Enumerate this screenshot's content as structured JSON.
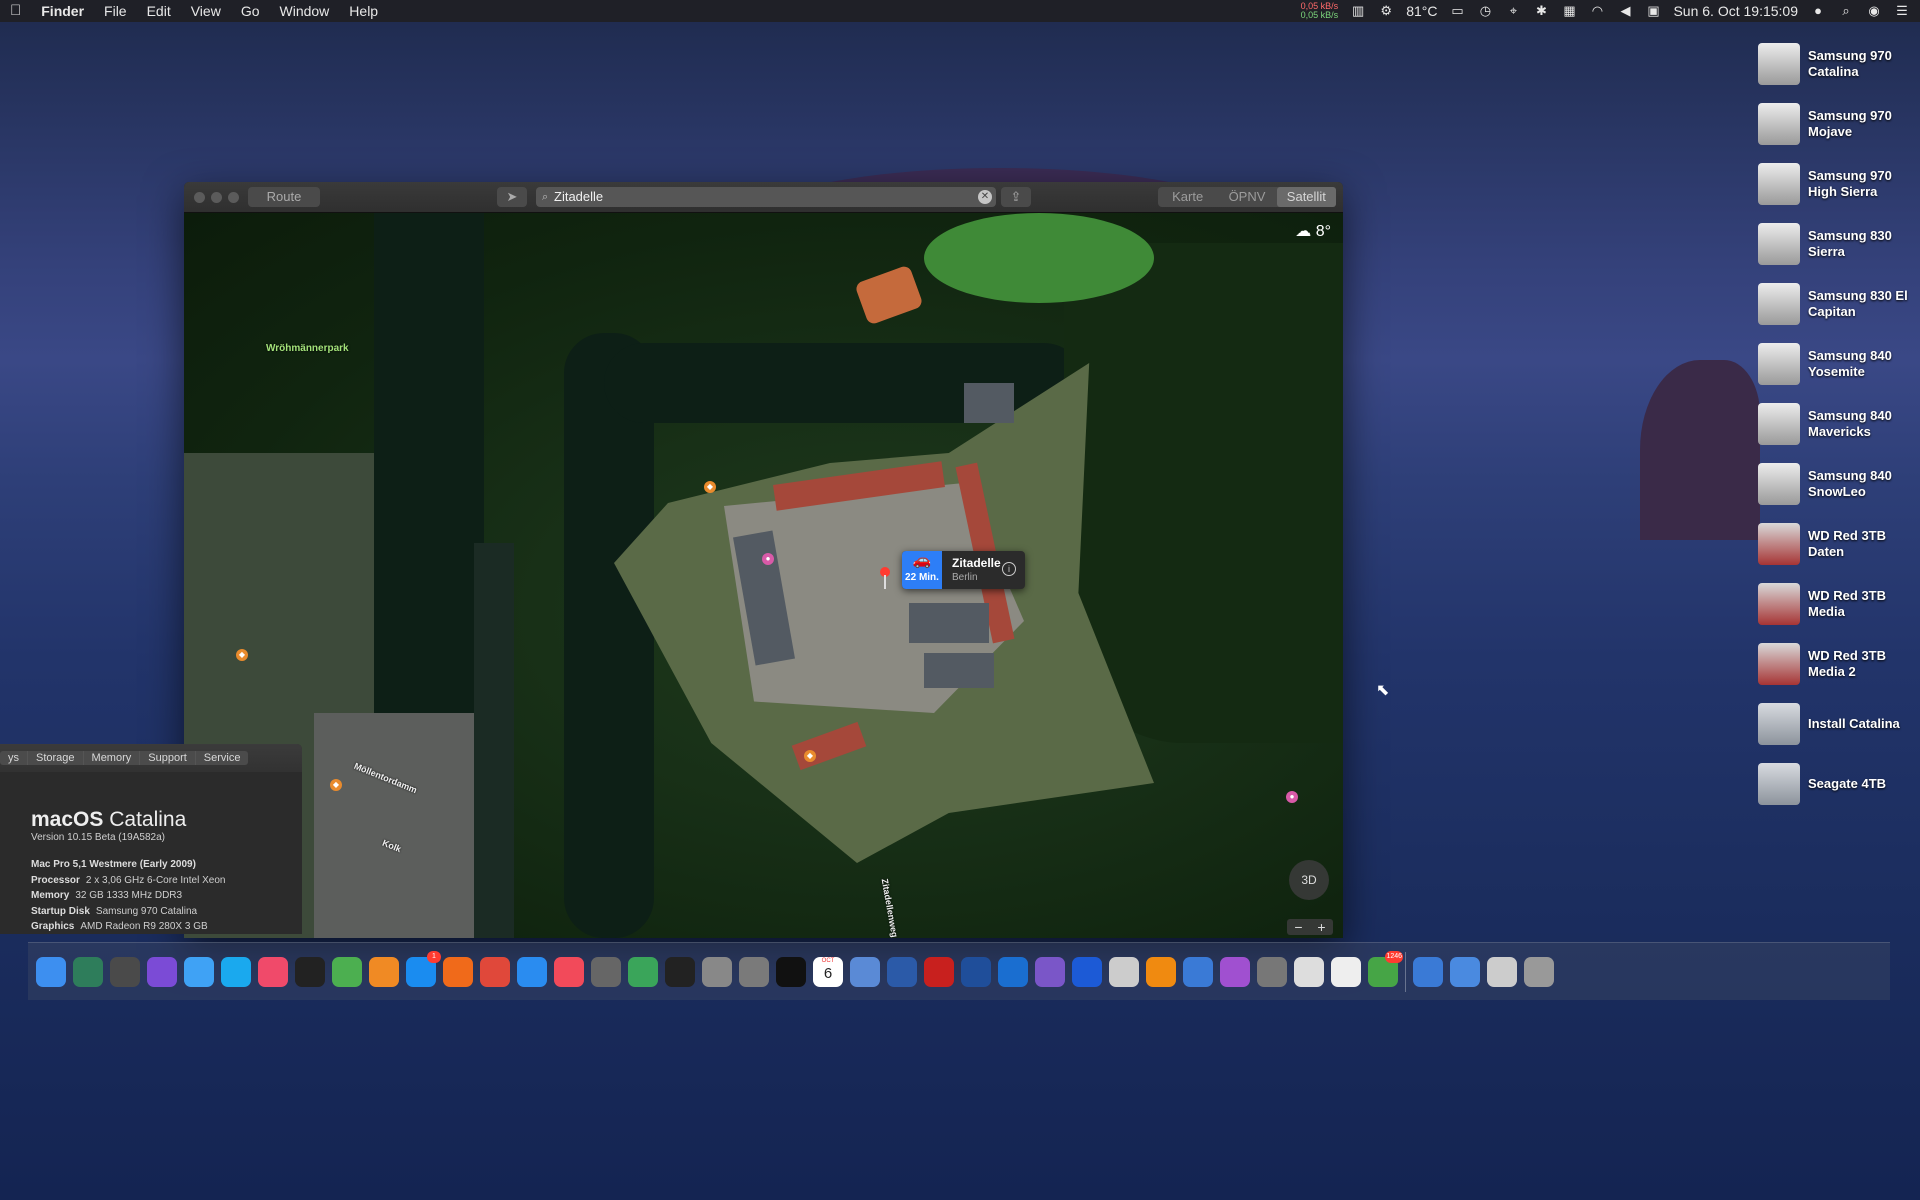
{
  "menubar": {
    "app": "Finder",
    "menus": [
      "File",
      "Edit",
      "View",
      "Go",
      "Window",
      "Help"
    ],
    "net_up": "0,05 kB/s",
    "net_down": "0,05 kB/s",
    "temp": "81°C",
    "datetime": "Sun 6. Oct  19:15:09"
  },
  "desktop": [
    {
      "line1": "Samsung 970",
      "line2": "Catalina",
      "kind": "ssd"
    },
    {
      "line1": "Samsung 970",
      "line2": "Mojave",
      "kind": "ssd"
    },
    {
      "line1": "Samsung 970",
      "line2": "High Sierra",
      "kind": "ssd"
    },
    {
      "line1": "Samsung 830",
      "line2": "Sierra",
      "kind": "ssd"
    },
    {
      "line1": "Samsung 830 El",
      "line2": "Capitan",
      "kind": "ssd"
    },
    {
      "line1": "Samsung 840",
      "line2": "Yosemite",
      "kind": "ssd"
    },
    {
      "line1": "Samsung 840",
      "line2": "Mavericks",
      "kind": "ssd"
    },
    {
      "line1": "Samsung 840",
      "line2": "SnowLeo",
      "kind": "ssd"
    },
    {
      "line1": "WD Red 3TB",
      "line2": "Daten",
      "kind": "wd"
    },
    {
      "line1": "WD Red 3TB",
      "line2": "Media",
      "kind": "wd"
    },
    {
      "line1": "WD Red 3TB",
      "line2": "Media 2",
      "kind": "wd"
    },
    {
      "line1": "Install Catalina",
      "line2": "",
      "kind": "installer"
    },
    {
      "line1": "Seagate 4TB",
      "line2": "",
      "kind": "timemachine"
    }
  ],
  "maps": {
    "route_label": "Route",
    "search_value": "Zitadelle",
    "modes": [
      "Karte",
      "ÖPNV",
      "Satellit"
    ],
    "active_mode": "Satellit",
    "weather": "8°",
    "park_label": "Wröhmännerpark",
    "street_labels": [
      "Möllentordamm",
      "Kolk",
      "Zitadellenweg"
    ],
    "callout": {
      "title": "Zitadelle",
      "subtitle": "Berlin",
      "eta": "22 Min."
    },
    "compass_label": "3D",
    "zoom_out": "−",
    "zoom_in": "+"
  },
  "about": {
    "tabs": [
      "ys",
      "Storage",
      "Memory",
      "Support",
      "Service"
    ],
    "os_name": "macOS",
    "os_codename": "Catalina",
    "version": "Version 10.15 Beta (19A582a)",
    "machine": "Mac Pro 5,1 Westmere (Early 2009)",
    "specs": [
      {
        "k": "Processor",
        "v": "2 x 3,06 GHz 6-Core Intel Xeon"
      },
      {
        "k": "Memory",
        "v": "32 GB 1333 MHz DDR3"
      },
      {
        "k": "Startup Disk",
        "v": "Samsung 970 Catalina"
      },
      {
        "k": "Graphics",
        "v": "AMD Radeon R9 280X 3 GB"
      }
    ]
  },
  "dock": {
    "calendar_month": "OCT",
    "calendar_day": "6",
    "badge_appstore": "1",
    "badge_mail": "1246",
    "apps": [
      "finder",
      "preview",
      "system-information",
      "siri",
      "messages",
      "skype",
      "music",
      "apple-tv",
      "maps",
      "books",
      "app-store",
      "firefox",
      "chrome",
      "safari",
      "news",
      "launchpad",
      "iStat",
      "activity-monitor",
      "script-editor",
      "system-preferences",
      "terminal",
      "calendar",
      "photo-viewer",
      "word",
      "acrobat",
      "photoshop",
      "outlook",
      "movie",
      "quicktime",
      "disk",
      "vlc",
      "airdrop",
      "podcasts",
      "printer",
      "screenshot",
      "textedit",
      "mail",
      "downloads",
      "applications",
      "display",
      "trash"
    ]
  }
}
